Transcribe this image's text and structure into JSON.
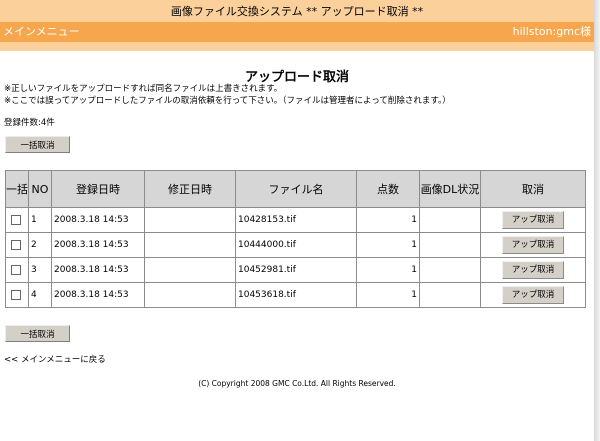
{
  "header": {
    "title": "画像ファイル交換システム ** アップロード取消 **",
    "menu_link": "メインメニュー",
    "user": "hillston:gmc様"
  },
  "page": {
    "title": "アップロード取消",
    "note1": "※正しいファイルをアップロードすれば同名ファイルは上書きされます。",
    "note2": "※ここでは誤ってアップロードしたファイルの取消依頼を行って下さい。（ファイルは管理者によって削除されます。）",
    "count": "登録件数:4件",
    "bulk_cancel_label": "一括取消",
    "back_link": "<< メインメニューに戻る"
  },
  "table": {
    "headers": {
      "bulk": "一括",
      "no": "NO",
      "registered": "登録日時",
      "modified": "修正日時",
      "filename": "ファイル名",
      "points": "点数",
      "dl_status": "画像DL状況",
      "cancel": "取消"
    },
    "rows": [
      {
        "no": "1",
        "registered": "2008.3.18 14:53",
        "modified": "",
        "filename": "10428153.tif",
        "points": "1",
        "dl_status": "",
        "cancel_label": "アップ取消"
      },
      {
        "no": "2",
        "registered": "2008.3.18 14:53",
        "modified": "",
        "filename": "10444000.tif",
        "points": "1",
        "dl_status": "",
        "cancel_label": "アップ取消"
      },
      {
        "no": "3",
        "registered": "2008.3.18 14:53",
        "modified": "",
        "filename": "10452981.tif",
        "points": "1",
        "dl_status": "",
        "cancel_label": "アップ取消"
      },
      {
        "no": "4",
        "registered": "2008.3.18 14:53",
        "modified": "",
        "filename": "10453618.tif",
        "points": "1",
        "dl_status": "",
        "cancel_label": "アップ取消"
      }
    ]
  },
  "footer": {
    "copyright": "(C) Copyright 2008 GMC Co.Ltd. All Rights Reserved."
  }
}
